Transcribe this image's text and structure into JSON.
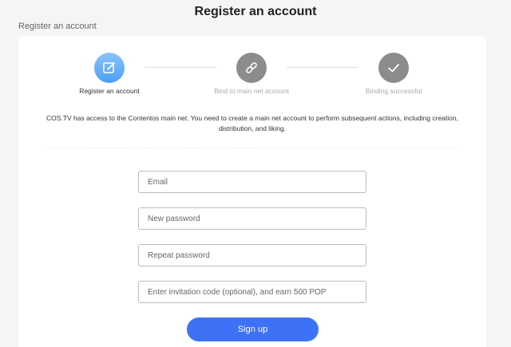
{
  "page": {
    "title": "Register an account",
    "breadcrumb": "Register an account"
  },
  "steps": [
    {
      "label": "Register an account",
      "icon": "edit-icon",
      "state": "active",
      "color": "#4aa0f4"
    },
    {
      "label": "Bind to main net account",
      "icon": "link-icon",
      "state": "inactive",
      "color": "#8c8c8c"
    },
    {
      "label": "Binding successful",
      "icon": "check-icon",
      "state": "inactive",
      "color": "#8c8c8c"
    }
  ],
  "description": "COS.TV has access to the Contentos main net. You need to create a main net account to perform subsequent actions, including creation, distribution, and liking.",
  "form": {
    "email_placeholder": "Email",
    "new_password_placeholder": "New password",
    "repeat_password_placeholder": "Repeat password",
    "invitation_placeholder": "Enter invitation code (optional), and earn 500 POP",
    "signup_label": "Sign up"
  },
  "colors": {
    "accent": "#3d72f6",
    "background": "#f5f5f5"
  }
}
